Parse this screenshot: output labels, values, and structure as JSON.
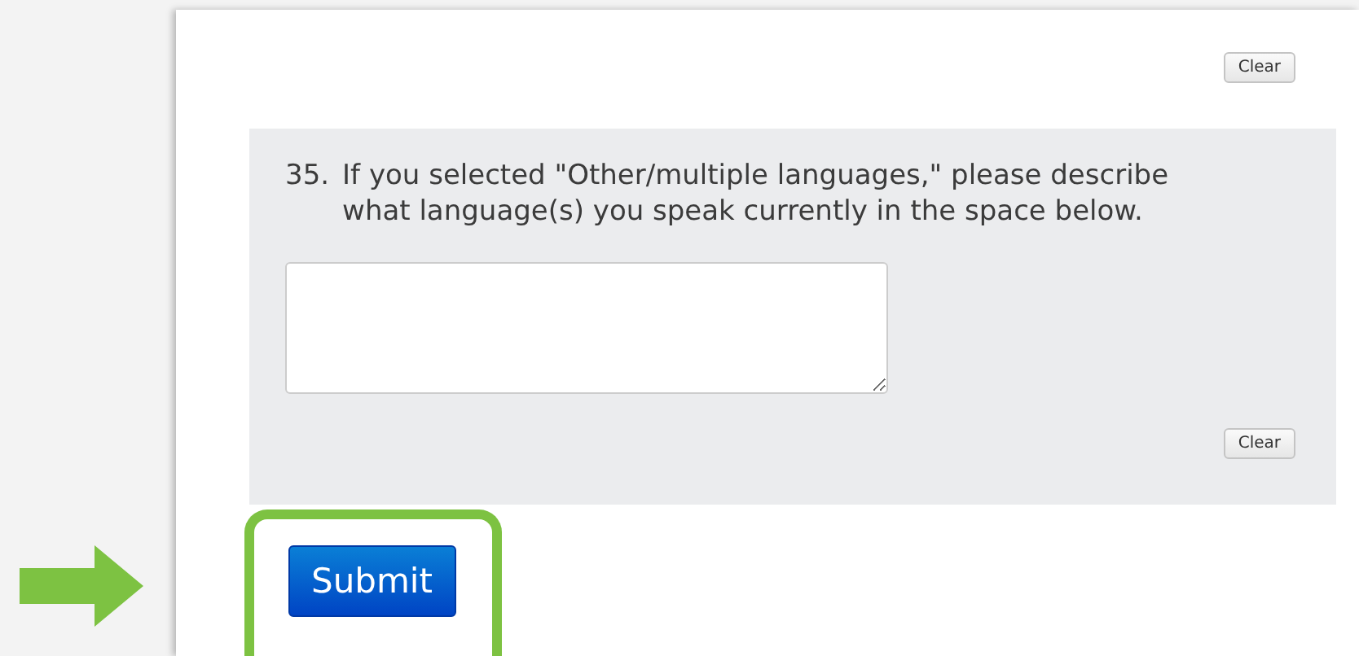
{
  "top_clear_button": "Clear",
  "question": {
    "number": "35.",
    "text": "If you selected \"Other/multiple languages,\" please describe what language(s) you speak currently in the space below.",
    "clear_button": "Clear"
  },
  "submit_button": "Submit",
  "highlight": {
    "on": true
  }
}
